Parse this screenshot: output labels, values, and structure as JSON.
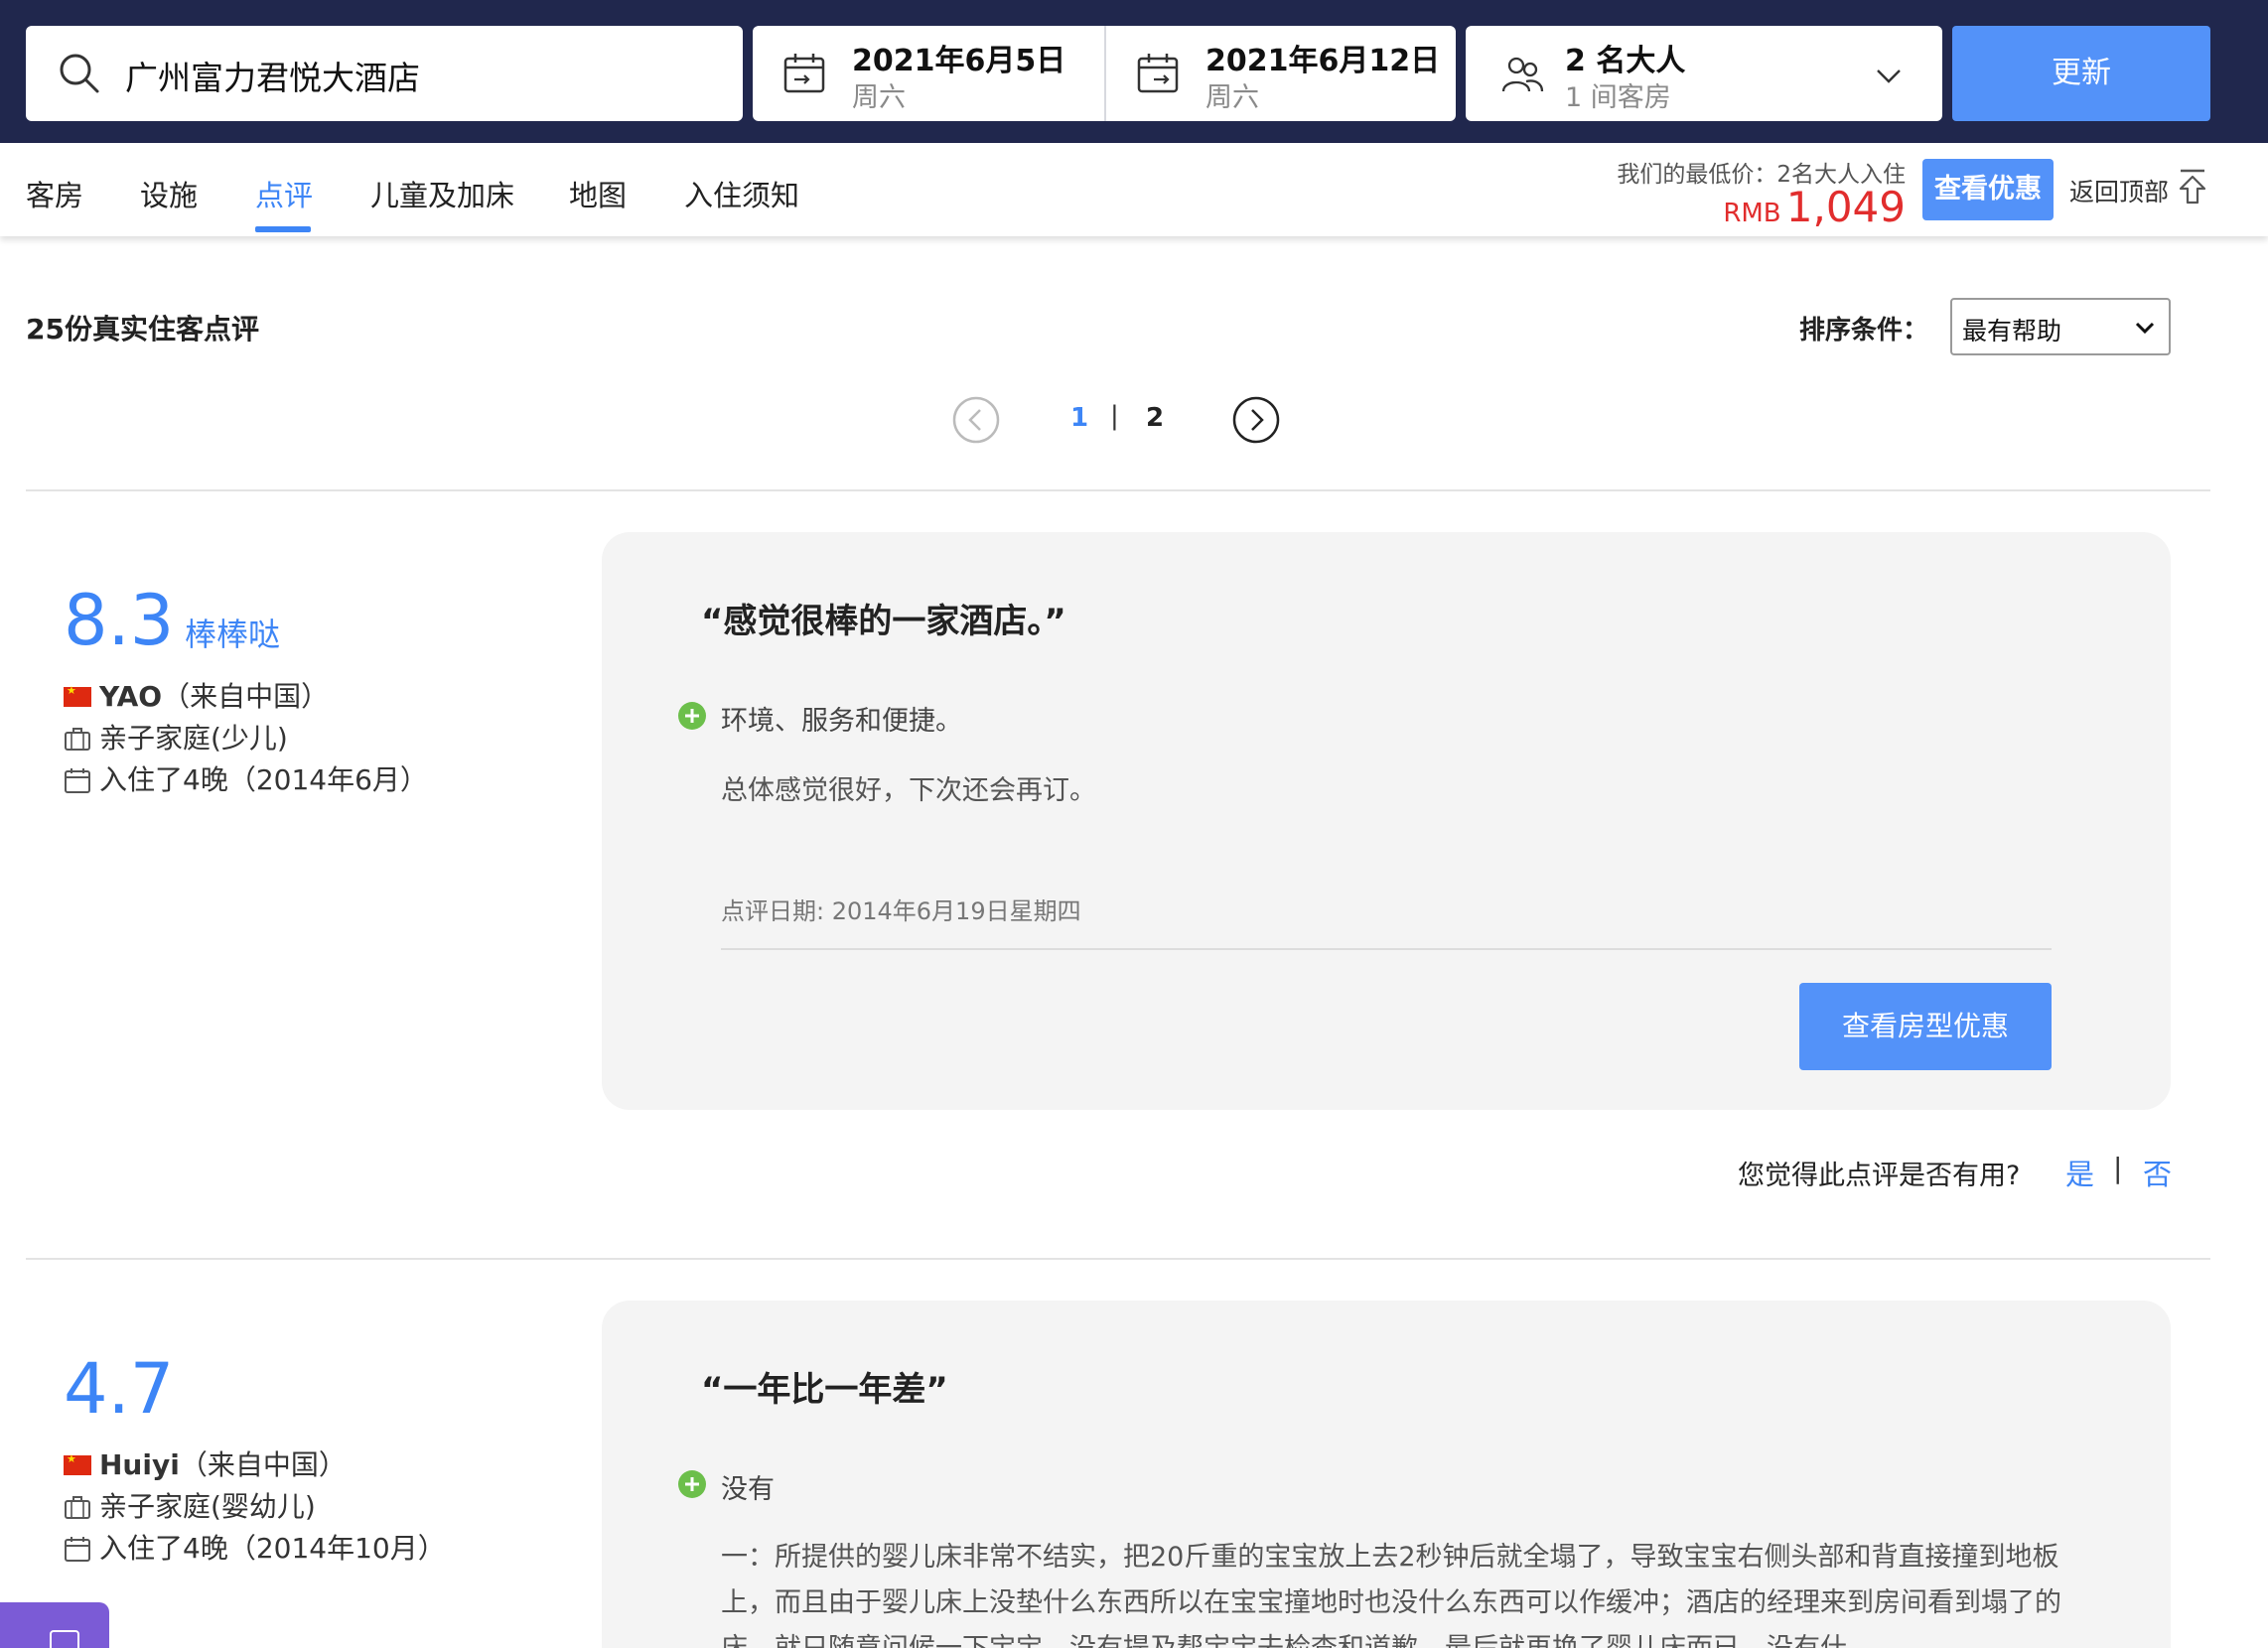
{
  "search": {
    "hotel": "广州富力君悦大酒店",
    "checkin_date": "2021年6月5日",
    "checkin_day": "周六",
    "checkout_date": "2021年6月12日",
    "checkout_day": "周六",
    "guests": "2 名大人",
    "rooms": "1 间客房",
    "update_label": "更新"
  },
  "tabs": [
    {
      "label": "客房"
    },
    {
      "label": "设施"
    },
    {
      "label": "点评",
      "active": true
    },
    {
      "label": "儿童及加床"
    },
    {
      "label": "地图"
    },
    {
      "label": "入住须知"
    }
  ],
  "price": {
    "label": "我们的最低价：2名大人入住",
    "currency": "RMB",
    "amount": "1,049",
    "deal_label": "查看优惠",
    "back_to_top": "返回顶部"
  },
  "reviews_header": {
    "count_text": "25份真实住客点评",
    "sort_label": "排序条件：",
    "sort_value": "最有帮助"
  },
  "pagination": {
    "pages": [
      "1",
      "2"
    ],
    "current": "1",
    "separator": "|"
  },
  "reviews": [
    {
      "score": "8.3",
      "score_word": "棒棒哒",
      "reviewer": "YAO",
      "origin": "（来自中国）",
      "traveler_type": "亲子家庭(少儿)",
      "stay": "入住了4晚（2014年6月）",
      "title": "“感觉很棒的一家酒店。”",
      "positive": "环境、服务和便捷。",
      "body": "总体感觉很好，下次还会再订。",
      "date": "点评日期: 2014年6月19日星期四",
      "room_button": "查看房型优惠"
    },
    {
      "score": "4.7",
      "score_word": "",
      "reviewer": "Huiyi",
      "origin": "（来自中国）",
      "traveler_type": "亲子家庭(婴幼儿)",
      "stay": "入住了4晚（2014年10月）",
      "title": "“一年比一年差”",
      "positive": "没有",
      "body": "一：所提供的婴儿床非常不结实，把20斤重的宝宝放上去2秒钟后就全塌了，导致宝宝右侧头部和背直接撞到地板上，而且由于婴儿床上没垫什么东西所以在宝宝撞地时也没什么东西可以作缓冲；酒店的经理来到房间看到塌了的床，就只随意问候一下宝宝，没有提及帮宝宝去检查和道歉，最后就再换了婴儿床而已，没有什"
    }
  ],
  "helpful": {
    "question": "您觉得此点评是否有用?",
    "yes": "是",
    "separator": "|",
    "no": "否"
  },
  "colors": {
    "navy": "#20274d",
    "accent": "#5392f9",
    "link": "#3d85f6",
    "price_red": "#e12d2d",
    "positive_green": "#6cbf4b"
  }
}
